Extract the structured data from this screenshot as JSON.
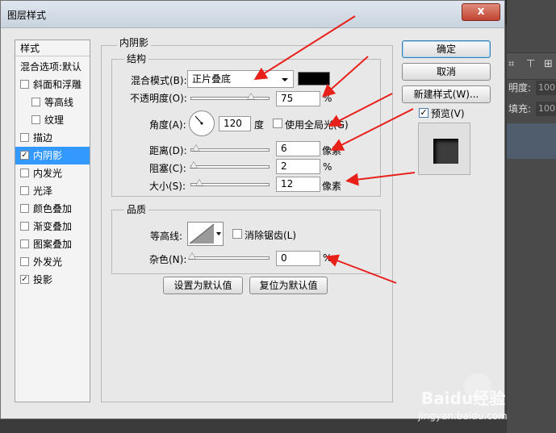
{
  "background": {
    "layer_opacity_label": "明度:",
    "layer_opacity_value": "100",
    "fill_label": "填充:",
    "fill_value": "100"
  },
  "window": {
    "title": "图层样式",
    "close_symbol": "x"
  },
  "left_panel": {
    "header": "样式",
    "items": [
      {
        "label": "混合选项:默认",
        "checkbox": false,
        "checked": false,
        "selected": false
      },
      {
        "label": "斜面和浮雕",
        "checkbox": true,
        "checked": false,
        "selected": false
      },
      {
        "label": "等高线",
        "checkbox": true,
        "checked": false,
        "selected": false,
        "indent": true
      },
      {
        "label": "纹理",
        "checkbox": true,
        "checked": false,
        "selected": false,
        "indent": true
      },
      {
        "label": "描边",
        "checkbox": true,
        "checked": false,
        "selected": false
      },
      {
        "label": "内阴影",
        "checkbox": true,
        "checked": true,
        "selected": true
      },
      {
        "label": "内发光",
        "checkbox": true,
        "checked": false,
        "selected": false
      },
      {
        "label": "光泽",
        "checkbox": true,
        "checked": false,
        "selected": false
      },
      {
        "label": "颜色叠加",
        "checkbox": true,
        "checked": false,
        "selected": false
      },
      {
        "label": "渐变叠加",
        "checkbox": true,
        "checked": false,
        "selected": false
      },
      {
        "label": "图案叠加",
        "checkbox": true,
        "checked": false,
        "selected": false
      },
      {
        "label": "外发光",
        "checkbox": true,
        "checked": false,
        "selected": false
      },
      {
        "label": "投影",
        "checkbox": true,
        "checked": true,
        "selected": false
      }
    ]
  },
  "inner_shadow": {
    "section_title": "内阴影",
    "structure": {
      "title": "结构",
      "blend_mode_label": "混合模式(B):",
      "blend_mode_value": "正片叠底",
      "shadow_color": "#000000",
      "opacity_label": "不透明度(O):",
      "opacity_value": "75",
      "opacity_unit": "%",
      "angle_label": "角度(A):",
      "angle_value": "120",
      "angle_unit": "度",
      "global_light_label": "使用全局光(G)",
      "global_light_checked": false,
      "distance_label": "距离(D):",
      "distance_value": "6",
      "distance_unit": "像素",
      "choke_label": "阻塞(C):",
      "choke_value": "2",
      "choke_unit": "%",
      "size_label": "大小(S):",
      "size_value": "12",
      "size_unit": "像素"
    },
    "quality": {
      "title": "品质",
      "contour_label": "等高线:",
      "antialias_label": "消除锯齿(L)",
      "antialias_checked": false,
      "noise_label": "杂色(N):",
      "noise_value": "0",
      "noise_unit": "%"
    },
    "set_default_label": "设置为默认值",
    "reset_default_label": "复位为默认值"
  },
  "actions": {
    "ok_label": "确定",
    "cancel_label": "取消",
    "new_style_label": "新建样式(W)...",
    "preview_label": "预览(V)",
    "preview_checked": true
  },
  "watermark": {
    "brand": "Baidu经验",
    "url": "jingyan.baidu.com"
  },
  "accent_colors": {
    "selection": "#3399ff",
    "arrow": "#e8201a",
    "default_button_border": "#3c7fb1"
  }
}
